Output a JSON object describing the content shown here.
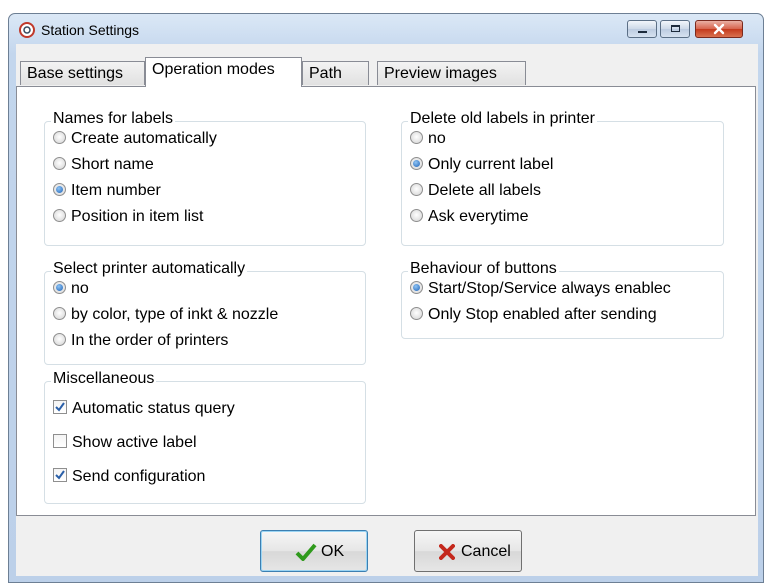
{
  "window": {
    "title": "Station Settings"
  },
  "tabs": [
    {
      "label": "Base settings"
    },
    {
      "label": "Operation modes"
    },
    {
      "label": "Path"
    },
    {
      "label": "Preview images"
    }
  ],
  "groups": {
    "names_for_labels": {
      "title": "Names for labels",
      "options": [
        {
          "label": "Create automatically",
          "selected": false
        },
        {
          "label": "Short name",
          "selected": false
        },
        {
          "label": "Item number",
          "selected": true
        },
        {
          "label": "Position in item list",
          "selected": false
        }
      ]
    },
    "select_printer": {
      "title": "Select printer automatically",
      "options": [
        {
          "label": "no",
          "selected": true
        },
        {
          "label": "by color, type of inkt & nozzle",
          "selected": false
        },
        {
          "label": "In the order of printers",
          "selected": false
        }
      ]
    },
    "miscellaneous": {
      "title": "Miscellaneous",
      "options": [
        {
          "label": "Automatic status query",
          "checked": true
        },
        {
          "label": "Show active label",
          "checked": false
        },
        {
          "label": "Send configuration",
          "checked": true
        }
      ]
    },
    "delete_old_labels": {
      "title": "Delete old labels in printer",
      "options": [
        {
          "label": "no",
          "selected": false
        },
        {
          "label": "Only current label",
          "selected": true
        },
        {
          "label": "Delete all labels",
          "selected": false
        },
        {
          "label": "Ask everytime",
          "selected": false
        }
      ]
    },
    "behaviour_of_buttons": {
      "title": "Behaviour of buttons",
      "options": [
        {
          "label": "Start/Stop/Service always enablec",
          "selected": true
        },
        {
          "label": "Only Stop enabled after sending",
          "selected": false
        }
      ]
    }
  },
  "buttons": {
    "ok": "OK",
    "cancel": "Cancel"
  },
  "colors": {
    "ok_check": "#2f9a1c",
    "cancel_x": "#c4281c",
    "selection": "#1e63b8"
  }
}
